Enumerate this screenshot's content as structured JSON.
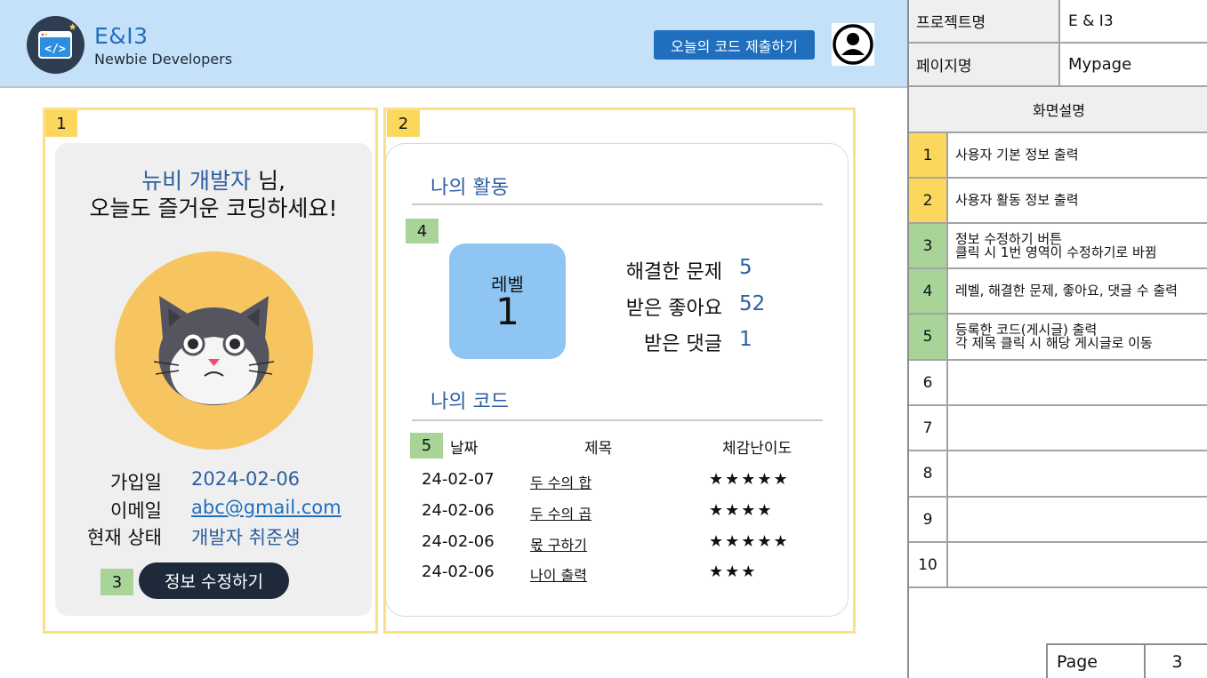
{
  "header": {
    "brand_name": "E&I3",
    "brand_sub": "Newbie Developers",
    "submit_button": "오늘의 코드 제출하기",
    "colors": {
      "header_bg": "#c4e1f9",
      "accent": "#1f6fbe"
    }
  },
  "badges": {
    "b1": "1",
    "b2": "2",
    "b3": "3",
    "b4": "4",
    "b5": "5"
  },
  "profile": {
    "greeting_name": "뉴비 개발자",
    "greeting_suffix": " 님,",
    "greeting_line2": "오늘도 즐거운 코딩하세요!",
    "join_label": "가입일",
    "join_value": "2024-02-06",
    "email_label": "이메일",
    "email_value": "abc@gmail.com",
    "status_label": "현재 상태",
    "status_value": "개발자 취준생",
    "edit_button": "정보 수정하기"
  },
  "activity": {
    "title": "나의 활동",
    "level_label": "레벨",
    "level_value": "1",
    "stats": [
      {
        "label": "해결한 문제",
        "value": "5"
      },
      {
        "label": "받은 좋아요",
        "value": "52"
      },
      {
        "label": "받은 댓글",
        "value": "1"
      }
    ]
  },
  "codes": {
    "title": "나의 코드",
    "columns": [
      "날짜",
      "제목",
      "체감난이도"
    ],
    "rows": [
      {
        "date": "24-02-07",
        "title": "두 수의 합",
        "stars": "★★★★★",
        "difficulty": 5
      },
      {
        "date": "24-02-06",
        "title": "두 수의 곱",
        "stars": "★★★★",
        "difficulty": 4
      },
      {
        "date": "24-02-06",
        "title": "몫 구하기",
        "stars": "★★★★★",
        "difficulty": 5
      },
      {
        "date": "24-02-06",
        "title": "나이 출력",
        "stars": "★★★",
        "difficulty": 3
      }
    ]
  },
  "spec": {
    "project_label": "프로젝트명",
    "project_value": "E & I3",
    "page_label": "페이지명",
    "page_value": "Mypage",
    "desc_header": "화면설명",
    "items": [
      {
        "num": "1",
        "line1": "사용자 기본 정보 출력",
        "line2": ""
      },
      {
        "num": "2",
        "line1": "사용자 활동 정보 출력",
        "line2": ""
      },
      {
        "num": "3",
        "line1": "정보 수정하기 버튼",
        "line2": "클릭 시 1번 영역이 수정하기로 바뀜"
      },
      {
        "num": "4",
        "line1": "레벨, 해결한 문제, 좋아요, 댓글 수 출력",
        "line2": ""
      },
      {
        "num": "5",
        "line1": "등록한 코드(게시글) 출력",
        "line2": "각 제목 클릭 시 해당 게시글로 이동"
      },
      {
        "num": "6",
        "line1": "",
        "line2": ""
      },
      {
        "num": "7",
        "line1": "",
        "line2": ""
      },
      {
        "num": "8",
        "line1": "",
        "line2": ""
      },
      {
        "num": "9",
        "line1": "",
        "line2": ""
      },
      {
        "num": "10",
        "line1": "",
        "line2": ""
      }
    ],
    "footer_page_label": "Page",
    "footer_page_value": "3"
  }
}
